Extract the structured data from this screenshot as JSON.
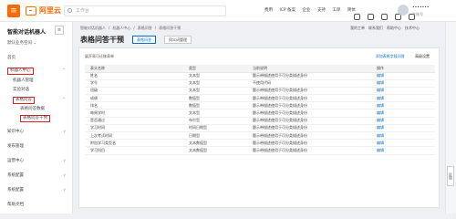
{
  "topbar": {
    "logo": "阿里云",
    "search_placeholder": "工作台",
    "links": [
      "费用",
      "ICP 备案",
      "企业",
      "支持",
      "工单",
      "简体"
    ],
    "icons": [
      "terminal-icon",
      "bell-icon",
      "cart-icon",
      "help-icon",
      "settings-icon"
    ],
    "user_name": "•••••••",
    "user_sub": "主账号"
  },
  "sidebar": {
    "title": "智能对话机器人",
    "collapse": "≡",
    "instance": "默认业务空间",
    "items": [
      {
        "label": "首页",
        "arrow": ""
      },
      {
        "label": "机器人中心",
        "arrow": "^"
      },
      {
        "label": "机器人管理",
        "arrow": ""
      },
      {
        "label": "实验对话",
        "arrow": ""
      },
      {
        "label": "表格问答",
        "arrow": "^"
      },
      {
        "label": "表格问答数据",
        "arrow": ""
      },
      {
        "label": "表格问答干预",
        "arrow": ""
      },
      {
        "label": "知识中心",
        "arrow": "v"
      },
      {
        "label": "发布管理",
        "arrow": ""
      },
      {
        "label": "运营中心",
        "arrow": "v"
      },
      {
        "label": "系统配置",
        "arrow": "v"
      },
      {
        "label": "系统配置",
        "arrow": "v"
      },
      {
        "label": "帮助文档",
        "arrow": ""
      }
    ]
  },
  "breadcrumb": [
    "智能对话机器人",
    "/",
    "机器人中心",
    "/",
    "表格问答",
    "/",
    "表格问答干预"
  ],
  "right_links": [
    "我的工单",
    "联系我们",
    "帮助中心",
    "技术中心"
  ],
  "page": {
    "title": "表格问答干预",
    "tab_active": "表格问答",
    "tab_other": "同义词管理"
  },
  "panel": {
    "head": "展开表可迁移表单",
    "link_add": "添加表格字段问答",
    "link_settings": "高级设置",
    "columns": [
      "表头名称",
      "类型",
      "当前说明",
      "操作"
    ],
    "rows": [
      [
        "姓名",
        "文本型",
        "题示带描述使用于可分类描述身份",
        "编辑"
      ],
      [
        "学号",
        "文本型",
        "不使用代码",
        "编辑"
      ],
      [
        "班级",
        "文本型",
        "题示带描述使用于可分类描述身份",
        "编辑"
      ],
      [
        "成绩",
        "数值型",
        "题示带描述使用于可分类描述身份",
        "编辑"
      ],
      [
        "排名",
        "数值型",
        "题示带描述使用于可分类描述身份",
        "编辑"
      ],
      [
        "每周学时",
        "文本型",
        "题示带描述使用于可分类描述身份",
        "编辑"
      ],
      [
        "是否通过",
        "布尔型",
        "题示带描述使用于可分类描述身份",
        "编辑"
      ],
      [
        "学习时间",
        "时间日期型",
        "题示带描述使用于可分类描述身份",
        "编辑"
      ],
      [
        "上次考试时间",
        "日期型",
        "题示带描述使用于可分类描述身份",
        "编辑"
      ],
      [
        "附加学习类型名",
        "文本数值型",
        "题示带描述使用于可分类描述身份",
        "编辑"
      ],
      [
        "学习科目",
        "文本数值型",
        "题示带描述使用于可分类描述身份",
        "编辑"
      ]
    ]
  },
  "feedback": "反馈"
}
